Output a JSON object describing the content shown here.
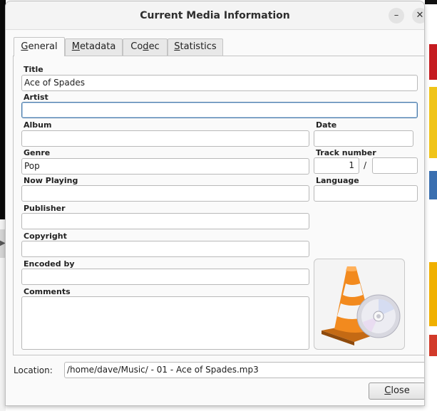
{
  "window": {
    "title": "Current Media Information",
    "minimize_glyph": "–",
    "close_glyph": "✕"
  },
  "tabs": [
    {
      "first": "G",
      "rest": "eneral"
    },
    {
      "first": "M",
      "rest": "etadata"
    },
    {
      "pre": "Co",
      "under": "d",
      "rest": "ec"
    },
    {
      "first": "S",
      "rest": "tatistics"
    }
  ],
  "fields": {
    "title_label": "Title",
    "title_value": "Ace of Spades",
    "artist_label": "Artist",
    "artist_value": "",
    "album_label": "Album",
    "album_value": "",
    "date_label": "Date",
    "date_value": "",
    "genre_label": "Genre",
    "genre_value": "Pop",
    "track_label": "Track number",
    "track_value": "1",
    "track_separator": "/",
    "track_total": "",
    "now_playing_label": "Now Playing",
    "now_playing_value": "",
    "language_label": "Language",
    "language_value": "",
    "publisher_label": "Publisher",
    "publisher_value": "",
    "copyright_label": "Copyright",
    "copyright_value": "",
    "encoded_by_label": "Encoded by",
    "encoded_by_value": "",
    "comments_label": "Comments",
    "comments_value": ""
  },
  "artwork": {
    "icon": "vlc-cone-disc-icon"
  },
  "location": {
    "label": "Location:",
    "value": "/home/dave/Music/ - 01 - Ace of Spades.mp3"
  },
  "close_button": {
    "first": "C",
    "rest": "lose"
  }
}
